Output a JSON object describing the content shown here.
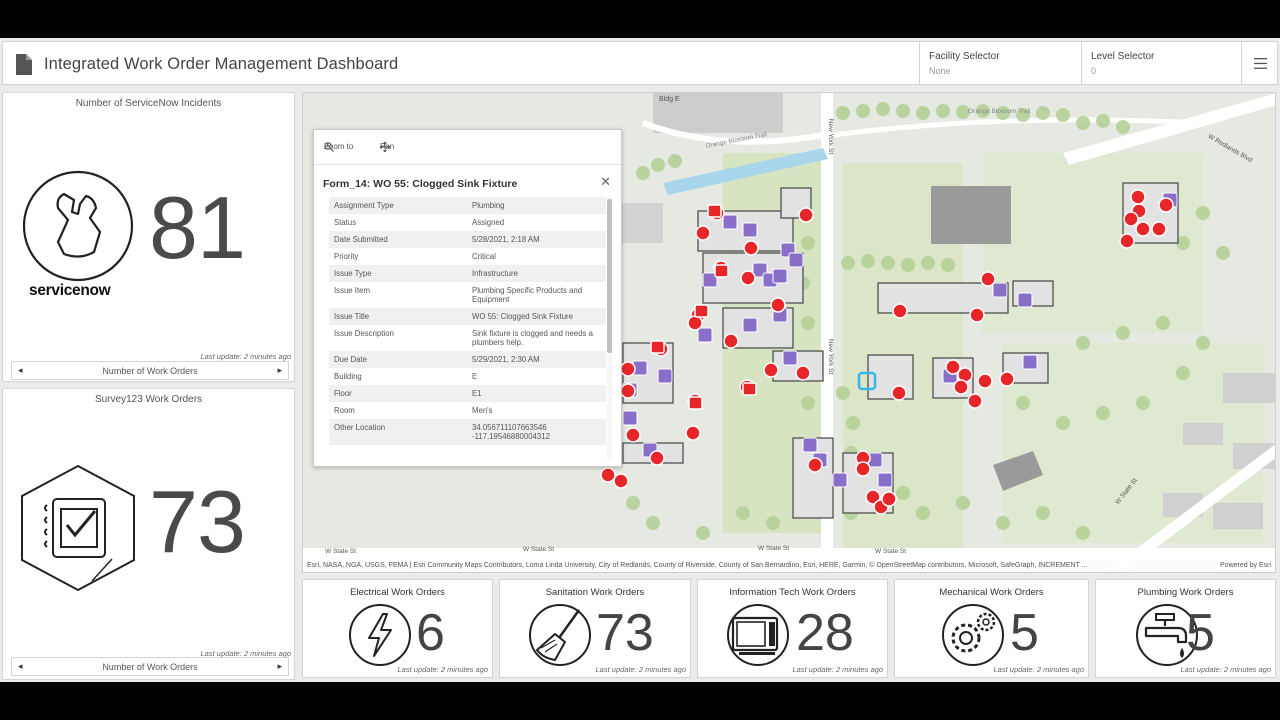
{
  "header": {
    "title": "Integrated Work Order Management Dashboard",
    "facility_selector": {
      "label": "Facility Selector",
      "value": "None"
    },
    "level_selector": {
      "label": "Level Selector",
      "value": "0"
    },
    "menu_icon": "hamburger-icon",
    "doc_icon": "document-icon"
  },
  "servicenow_panel": {
    "title": "Number of ServiceNow Incidents",
    "value": "81",
    "logo_text": "servicenow",
    "last_update": "Last update: 2 minutes ago",
    "nav_label": "Number of Work Orders"
  },
  "survey_panel": {
    "title": "Survey123 Work Orders",
    "value": "73",
    "last_update": "Last update: 2 minutes ago",
    "nav_label": "Number of Work Orders"
  },
  "popup": {
    "zoom_label": "Zoom to",
    "pan_label": "Pan",
    "title": "Form_14: WO 55: Clogged Sink Fixture",
    "fields": [
      {
        "label": "Assignment Type",
        "value": "Plumbing"
      },
      {
        "label": "Status",
        "value": "Assigned"
      },
      {
        "label": "Date Submitted",
        "value": "5/28/2021, 2:18 AM"
      },
      {
        "label": "Priority",
        "value": "Critical"
      },
      {
        "label": "Issue Type",
        "value": "Infrastructure"
      },
      {
        "label": "Issue Item",
        "value": "Plumbing Specific Products and Equipment"
      },
      {
        "label": "Issue Title",
        "value": "WO 55: Clogged Sink Fixture"
      },
      {
        "label": "Issue Description",
        "value": "Sink fixture is clogged and needs a plumbers help."
      },
      {
        "label": "Due Date",
        "value": "5/29/2021, 2:30 AM"
      },
      {
        "label": "Building",
        "value": "E"
      },
      {
        "label": "Floor",
        "value": "E1"
      },
      {
        "label": "Room",
        "value": "Men's"
      },
      {
        "label": "Other Location",
        "value": "34.056711107663546 -117.19546880004312"
      }
    ]
  },
  "map": {
    "labels": {
      "bldg_e": "Bldg E",
      "orange_blossom": "Orange Blossom Trail",
      "orange_blossom_2": "Orange Blossom Trail",
      "new_york_top": "New York St",
      "new_york_mid": "New York St",
      "w_redlands": "W Redlands Blvd",
      "w_state_1": "W State St",
      "w_state_2": "W State St",
      "w_state_3": "W State St",
      "w_state_4": "W State St",
      "w_state_diag": "W State St"
    },
    "attribution": "Esri, NASA, NGA, USGS, FEMA | Esri Community Maps Contributors, Loma Linda University, City of Redlands, County of Riverside, County of San Bernardino, Esri, HERE, Garmin, © OpenStreetMap contributors, Microsoft, SafeGraph, INCREMENT ...",
    "powered_by": "Powered by Esri"
  },
  "tiles": [
    {
      "title": "Electrical Work Orders",
      "value": "6",
      "icon": "lightning-icon",
      "last_update": "Last update: 2 minutes ago"
    },
    {
      "title": "Sanitation Work Orders",
      "value": "73",
      "icon": "broom-icon",
      "last_update": "Last update: 2 minutes ago"
    },
    {
      "title": "Information Tech Work Orders",
      "value": "28",
      "icon": "computer-icon",
      "last_update": "Last update: 2 minutes ago"
    },
    {
      "title": "Mechanical Work Orders",
      "value": "5",
      "icon": "gears-icon",
      "last_update": "Last update: 2 minutes ago"
    },
    {
      "title": "Plumbing Work Orders",
      "value": "5",
      "icon": "faucet-icon",
      "last_update": "Last update: 2 minutes ago"
    }
  ],
  "colors": {
    "incident_red": "#e8262a",
    "work_order_purple": "#8a6fc8",
    "building_outline": "#444444",
    "grass": "#d9e6c4",
    "tree": "#b7d29a"
  }
}
